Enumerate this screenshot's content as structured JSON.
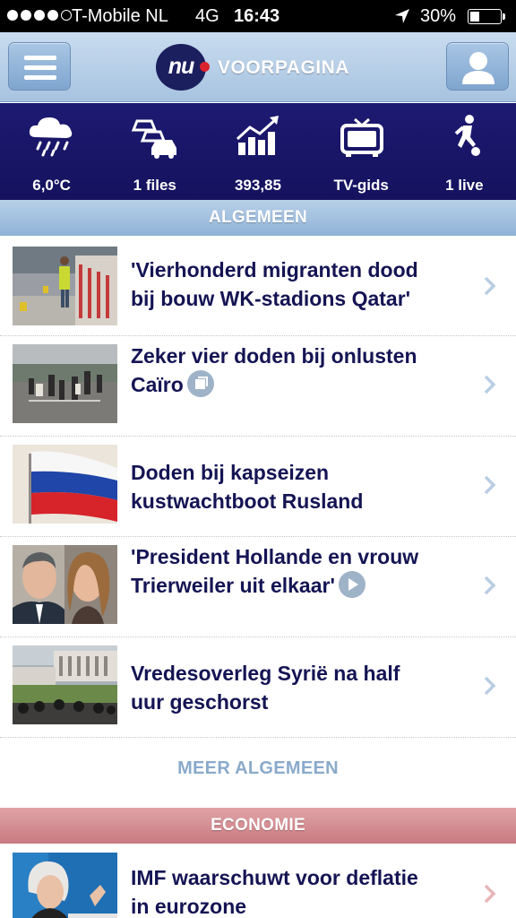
{
  "status_bar": {
    "carrier": "T-Mobile NL",
    "network": "4G",
    "time": "16:43",
    "battery": "30%",
    "battery_level": 0.3,
    "signal_bars_filled": 4,
    "signal_bars_total": 5
  },
  "header": {
    "logo_text": "nu",
    "title": "VOORPAGINA",
    "menu_icon": "hamburger-icon",
    "user_icon": "user-icon"
  },
  "widgets": [
    {
      "icon": "rain-cloud-icon",
      "label": "6,0°C"
    },
    {
      "icon": "traffic-cars-icon",
      "label": "1 files"
    },
    {
      "icon": "stock-chart-icon",
      "label": "393,85"
    },
    {
      "icon": "tv-icon",
      "label": "TV-gids"
    },
    {
      "icon": "soccer-player-icon",
      "label": "1 live"
    }
  ],
  "sections": {
    "algemeen": {
      "title": "ALGEMEEN",
      "more_label": "MEER ALGEMEEN",
      "items": [
        {
          "line1": "'Vierhonderd migranten dood",
          "line2": "bij bouw WK-stadions Qatar'",
          "badge": null
        },
        {
          "line1": "Zeker vier doden bij onlusten",
          "line2": "Caïro",
          "badge": "gallery-icon"
        },
        {
          "line1": "Doden bij kapseizen",
          "line2": "kustwachtboot Rusland",
          "badge": null
        },
        {
          "line1": "'President Hollande en vrouw",
          "line2": "Trierweiler uit elkaar'",
          "badge": "play-icon"
        },
        {
          "line1": "Vredesoverleg Syrië na half",
          "line2": "uur geschorst",
          "badge": null
        }
      ]
    },
    "economie": {
      "title": "ECONOMIE",
      "items": [
        {
          "line1": "IMF waarschuwt voor deflatie",
          "line2": "in eurozone",
          "badge": null
        }
      ]
    }
  },
  "colors": {
    "header": "#a7c3e0",
    "widget_bar": "#1d1a72",
    "headline": "#141454",
    "section_algemeen": "#8fb2d7",
    "section_economie": "#c87a80"
  }
}
